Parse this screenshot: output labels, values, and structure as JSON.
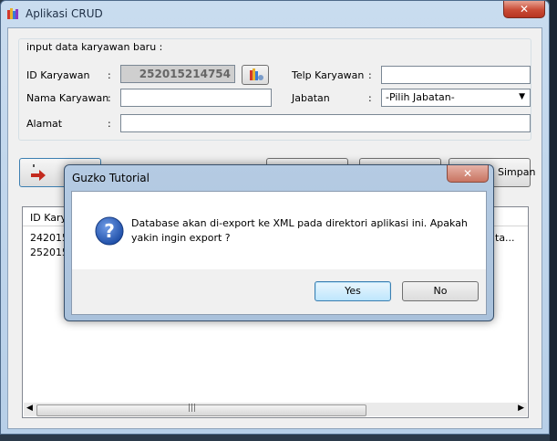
{
  "window": {
    "title": "Aplikasi CRUD",
    "close_glyph": "✕"
  },
  "form": {
    "group_title": "input data karyawan baru :",
    "id_label": "ID Karyawan",
    "id_value": "252015214754",
    "name_label": "Nama Karyawan",
    "address_label": "Alamat",
    "phone_label": "Telp Karyawan",
    "position_label": "Jabatan",
    "position_selected": "-Pilih Jabatan-",
    "colon": ":"
  },
  "toolbar": {
    "save_label": "Simpan"
  },
  "table": {
    "column_header": "ID Karya",
    "rows": [
      "242015",
      "252015"
    ],
    "overflow_text": "ta...",
    "scroll_grip": "|||"
  },
  "dialog": {
    "title": "Guzko Tutorial",
    "message": "Database akan di-export ke XML pada direktori aplikasi ini. Apakah yakin ingin export ?",
    "yes_label": "Yes",
    "no_label": "No",
    "close_glyph": "✕"
  },
  "colors": {
    "accent_red": "#c94b36",
    "question_blue": "#1f4fa8"
  }
}
